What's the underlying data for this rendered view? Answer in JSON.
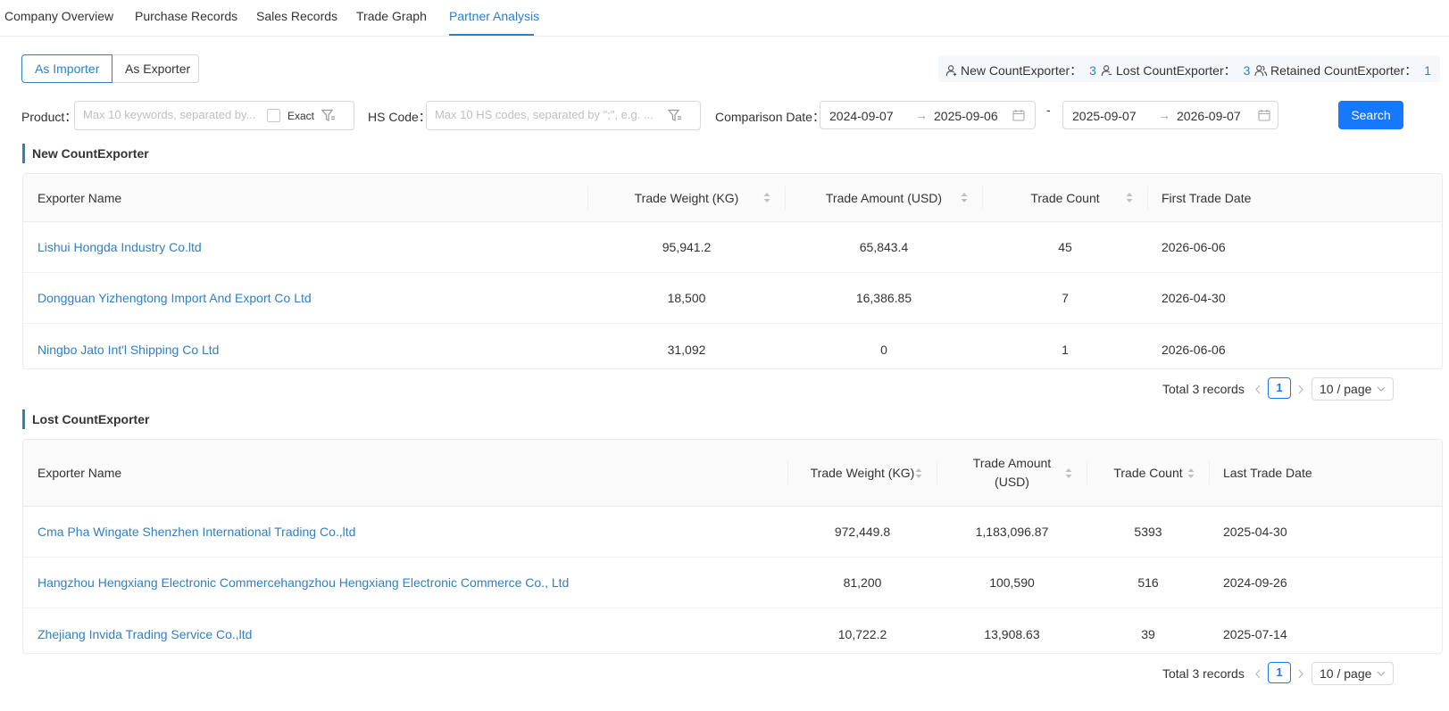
{
  "tabs": [
    {
      "label": "Company Overview"
    },
    {
      "label": "Purchase Records"
    },
    {
      "label": "Sales Records"
    },
    {
      "label": "Trade Graph"
    },
    {
      "label": "Partner Analysis"
    }
  ],
  "active_tab": "Partner Analysis",
  "role_toggle": {
    "importer": "As Importer",
    "exporter": "As Exporter",
    "selected": "As Importer"
  },
  "stats": {
    "new_label": "New CountExporter：",
    "new_value": "3",
    "lost_label": "Lost CountExporter：",
    "lost_value": "3",
    "retained_label": "Retained CountExporter：",
    "retained_value": "1"
  },
  "filters": {
    "product_label": "Product：",
    "product_placeholder": "Max 10 keywords, separated by...",
    "exact_label": "Exact",
    "hs_label": "HS Code：",
    "hs_placeholder": "Max 10 HS codes, separated by \";\", e.g. ...",
    "date_label": "Comparison Date：",
    "range1_start": "2024-09-07",
    "range1_end": "2025-09-06",
    "range_dash": "-",
    "range2_start": "2025-09-07",
    "range2_end": "2026-09-07",
    "arrow": "→",
    "search_label": "Search"
  },
  "new_section": {
    "title": "New CountExporter",
    "columns": [
      "Exporter Name",
      "Trade Weight (KG)",
      "Trade Amount (USD)",
      "Trade Count",
      "First Trade Date"
    ],
    "rows": [
      {
        "name": "Lishui Hongda Industry Co.ltd",
        "weight": "95,941.2",
        "amount": "65,843.4",
        "count": "45",
        "date": "2026-06-06"
      },
      {
        "name": "Dongguan Yizhengtong Import And Export Co Ltd",
        "weight": "18,500",
        "amount": "16,386.85",
        "count": "7",
        "date": "2026-04-30"
      },
      {
        "name": "Ningbo Jato Int'l Shipping Co Ltd",
        "weight": "31,092",
        "amount": "0",
        "count": "1",
        "date": "2026-06-06"
      }
    ],
    "pager": {
      "total": "Total 3 records",
      "page": "1",
      "size": "10 / page"
    }
  },
  "lost_section": {
    "title": "Lost CountExporter",
    "columns": [
      "Exporter Name",
      "Trade Weight (KG)",
      "Trade Amount (USD)",
      "Trade Count",
      "Last Trade Date"
    ],
    "rows": [
      {
        "name": "Cma Pha Wingate Shenzhen International Trading Co.,ltd",
        "weight": "972,449.8",
        "amount": "1,183,096.87",
        "count": "5393",
        "date": "2025-04-30"
      },
      {
        "name": "Hangzhou Hengxiang Electronic Commercehangzhou Hengxiang Electronic Commerce Co., Ltd",
        "weight": "81,200",
        "amount": "100,590",
        "count": "516",
        "date": "2024-09-26"
      },
      {
        "name": "Zhejiang Invida Trading Service Co.,ltd",
        "weight": "10,722.2",
        "amount": "13,908.63",
        "count": "39",
        "date": "2025-07-14"
      }
    ],
    "pager": {
      "total": "Total 3 records",
      "page": "1",
      "size": "10 / page"
    }
  },
  "icons": {
    "stat_new": "user-add-icon",
    "stat_lost": "user-remove-icon",
    "stat_retained": "users-icon",
    "filter": "filter-icon",
    "calendar": "calendar-icon",
    "sort": "sort-icon",
    "pager_prev": "chevron-left-icon",
    "pager_next": "chevron-right-icon",
    "dropdown": "chevron-down-icon"
  },
  "colors": {
    "accent": "#2f7fc7",
    "primary_button": "#1677ff",
    "header_bg": "#fafafa",
    "stats_bg": "#f4f8fc"
  }
}
